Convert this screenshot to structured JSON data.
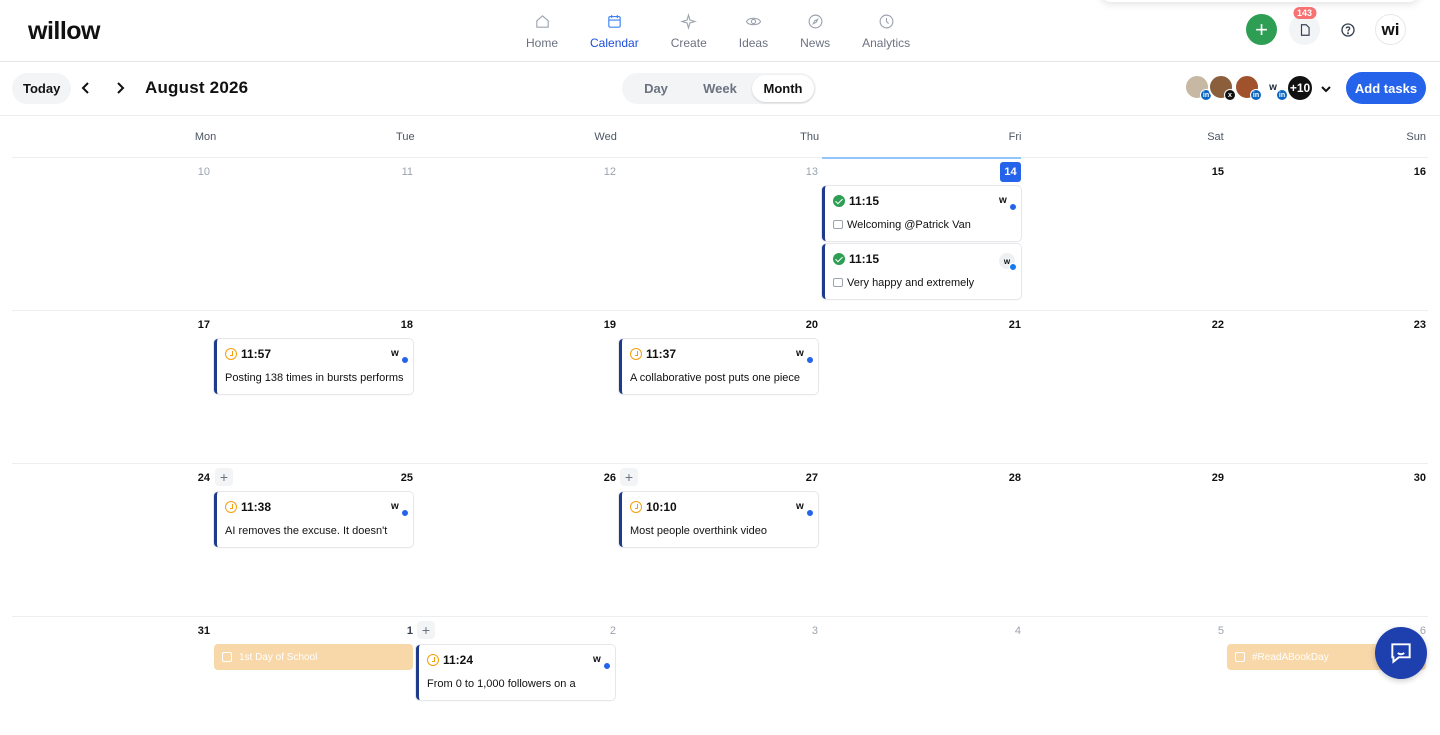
{
  "app": {
    "logo": "willow",
    "nav": [
      {
        "label": "Home",
        "icon": "home-icon"
      },
      {
        "label": "Calendar",
        "icon": "calendar-icon",
        "active": true
      },
      {
        "label": "Create",
        "icon": "sparkle-icon"
      },
      {
        "label": "Ideas",
        "icon": "eye-icon"
      },
      {
        "label": "News",
        "icon": "compass-icon"
      },
      {
        "label": "Analytics",
        "icon": "clock-icon"
      }
    ],
    "notification_count": "143",
    "workspace_initials": "wi"
  },
  "toolbar": {
    "today_label": "Today",
    "month_title": "August 2026",
    "views": [
      "Day",
      "Week",
      "Month"
    ],
    "active_view": "Month",
    "more_members": "+10",
    "add_tasks_label": "Add tasks"
  },
  "weekdays": [
    "Mon",
    "Tue",
    "Wed",
    "Thu",
    "Fri",
    "Sat",
    "Sun"
  ],
  "weeks": [
    {
      "days": [
        "10",
        "11",
        "12",
        "13",
        "14",
        "15",
        "16"
      ]
    },
    {
      "days": [
        "17",
        "18",
        "19",
        "20",
        "21",
        "22",
        "23"
      ]
    },
    {
      "days": [
        "24",
        "25",
        "26",
        "27",
        "28",
        "29",
        "30"
      ]
    },
    {
      "days": [
        "31",
        "1",
        "2",
        "3",
        "4",
        "5",
        "6"
      ]
    }
  ],
  "posts": [
    {
      "time": "11:15",
      "text": "Welcoming @Patrick Van",
      "status": "published"
    },
    {
      "time": "11:15",
      "text": "Very happy and extremely",
      "status": "published"
    },
    {
      "time": "11:57",
      "text": "Posting 138 times in bursts performs",
      "status": "scheduled"
    },
    {
      "time": "11:37",
      "text": "A collaborative post puts one piece",
      "status": "scheduled"
    },
    {
      "time": "11:38",
      "text": "AI removes the excuse. It doesn't",
      "status": "scheduled"
    },
    {
      "time": "10:10",
      "text": "Most people overthink video",
      "status": "scheduled"
    },
    {
      "time": "11:24",
      "text": "From 0 to 1,000 followers on a",
      "status": "scheduled"
    }
  ],
  "events": [
    {
      "label": "1st Day of School"
    },
    {
      "label": "#ReadABookDay"
    }
  ],
  "colors": {
    "accent": "#2563eb",
    "published": "#2e9e54",
    "scheduled": "#f59e0b",
    "event": "#f8d7a8"
  }
}
